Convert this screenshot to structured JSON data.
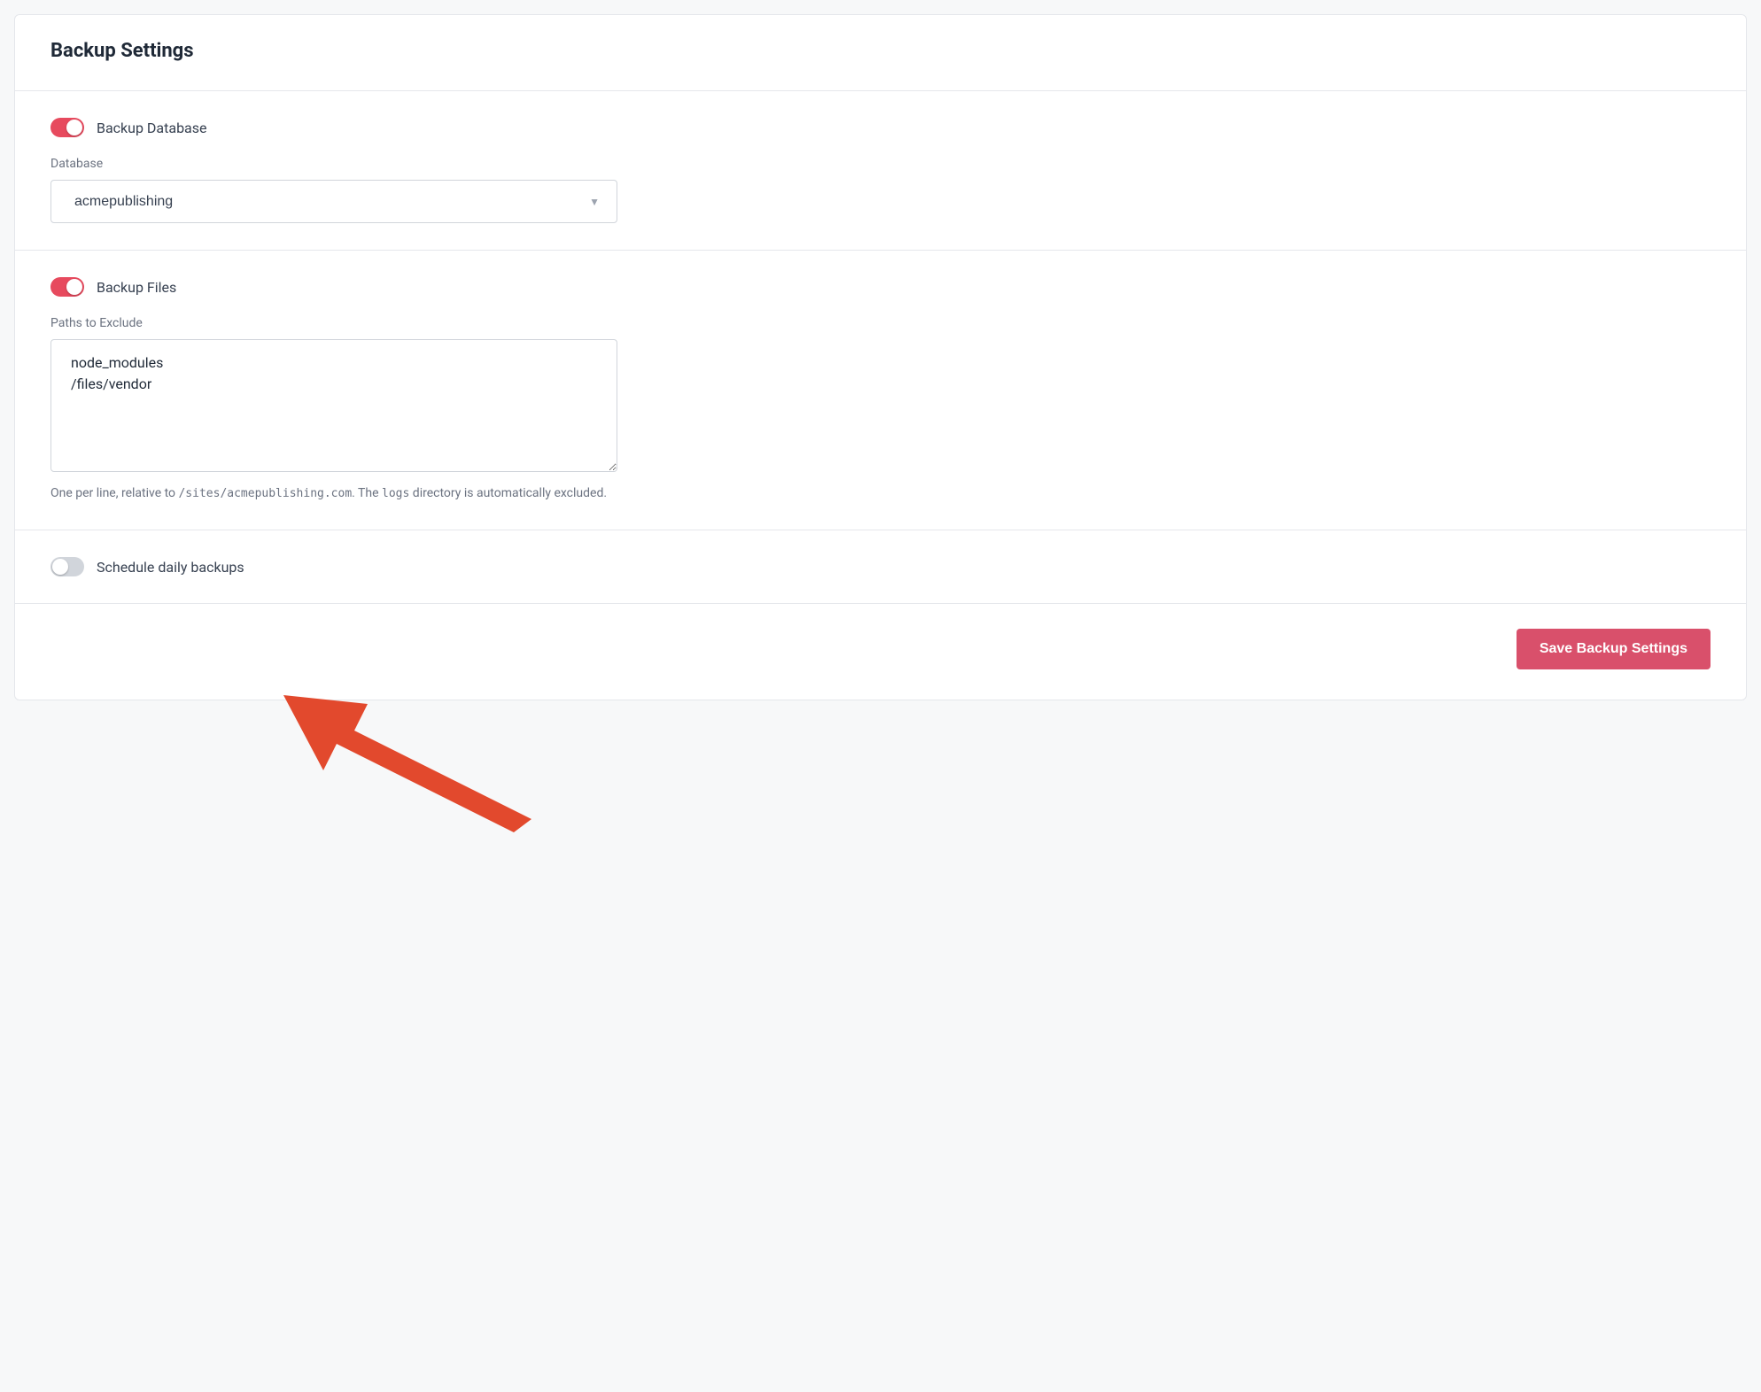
{
  "header": {
    "title": "Backup Settings"
  },
  "sections": {
    "database": {
      "toggle_label": "Backup Database",
      "toggle_on": true,
      "field_label": "Database",
      "selected_value": "acmepublishing"
    },
    "files": {
      "toggle_label": "Backup Files",
      "toggle_on": true,
      "field_label": "Paths to Exclude",
      "textarea_value": "node_modules\n/files/vendor",
      "help_prefix": "One per line, relative to ",
      "help_code1": "/sites/acmepublishing.com",
      "help_mid": ". The ",
      "help_code2": "logs",
      "help_suffix": " directory is automatically excluded."
    },
    "schedule": {
      "toggle_label": "Schedule daily backups",
      "toggle_on": false
    }
  },
  "footer": {
    "save_label": "Save Backup Settings"
  }
}
